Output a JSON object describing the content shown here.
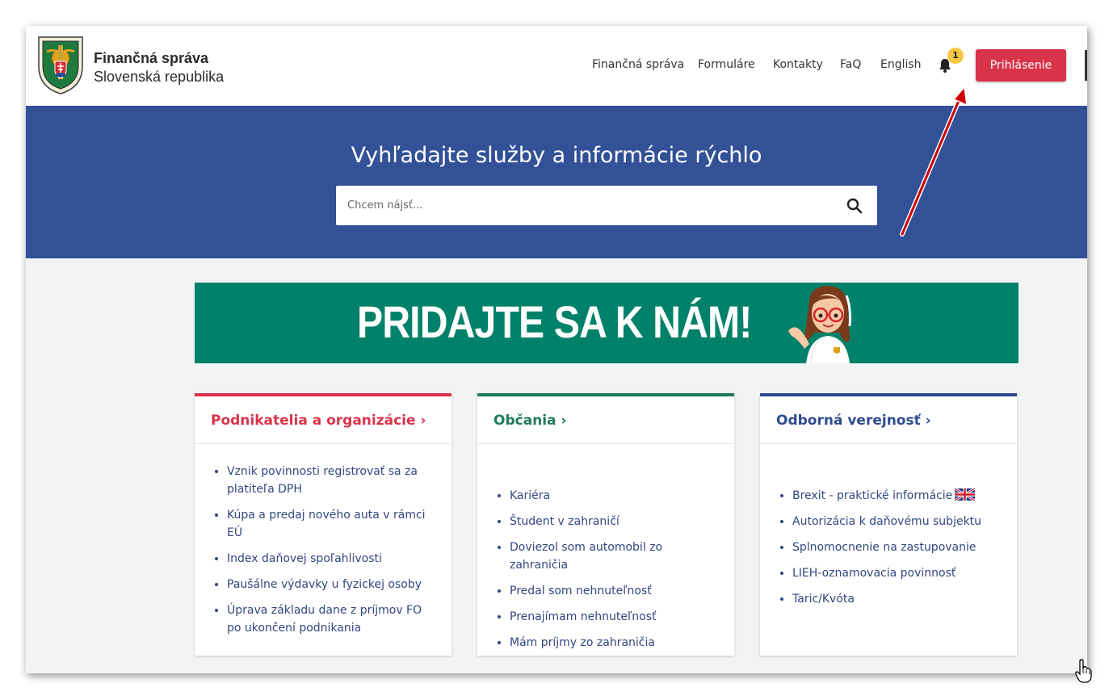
{
  "header": {
    "logo_line1": "Finančná správa",
    "logo_line2": "Slovenská republika",
    "nav": [
      {
        "label": "Finančná správa"
      },
      {
        "label": "Formuláre"
      },
      {
        "label": "Kontakty"
      },
      {
        "label": "FaQ"
      },
      {
        "label": "English"
      }
    ],
    "notification_count": "1",
    "login_label": "Prihlásenie"
  },
  "hero": {
    "title": "Vyhľadajte služby a informácie rýchlo",
    "search_placeholder": "Chcem nájsť..."
  },
  "banner": {
    "text": "PRIDAJTE SA K NÁM!"
  },
  "cards": [
    {
      "title": "Podnikatelia a organizácie ›",
      "color": "#d9334a",
      "items": [
        "Vznik povinnosti registrovať sa za platiteľa DPH",
        "Kúpa a predaj nového auta v rámci EÚ",
        "Index daňovej spoľahlivosti",
        "Paušálne výdavky u fyzickej osoby",
        "Úprava základu dane z príjmov FO po ukončení podnikania"
      ]
    },
    {
      "title": "Občania ›",
      "color": "#1f7a5f",
      "items": [
        "Kariéra",
        "Študent v zahraničí",
        "Doviezol som automobil zo zahraničia",
        "Predal som nehnuteľnosť",
        "Prenajímam nehnuteľnosť",
        "Mám príjmy zo zahraničia"
      ]
    },
    {
      "title": "Odborná verejnosť ›",
      "color": "#2f4b8f",
      "items": [
        "Brexit - praktické informácie",
        "Autorizácia k daňovému subjektu",
        "Splnomocnenie na zastupovanie",
        "LIEH-oznamovacia povinnosť",
        "Taric/Kvóta"
      ]
    }
  ],
  "colors": {
    "brand_blue": "#325197",
    "login_red": "#d9334a",
    "banner_green": "#008169",
    "badge_yellow": "#f7c744",
    "annotation_arrow": "#cc0000"
  },
  "icons": {
    "logo": "coat-of-arms-emblem",
    "notification": "bell-icon",
    "search": "magnifier-icon",
    "brexit_flag": "uk-flag-icon",
    "cursor": "hand-pointer-icon"
  }
}
